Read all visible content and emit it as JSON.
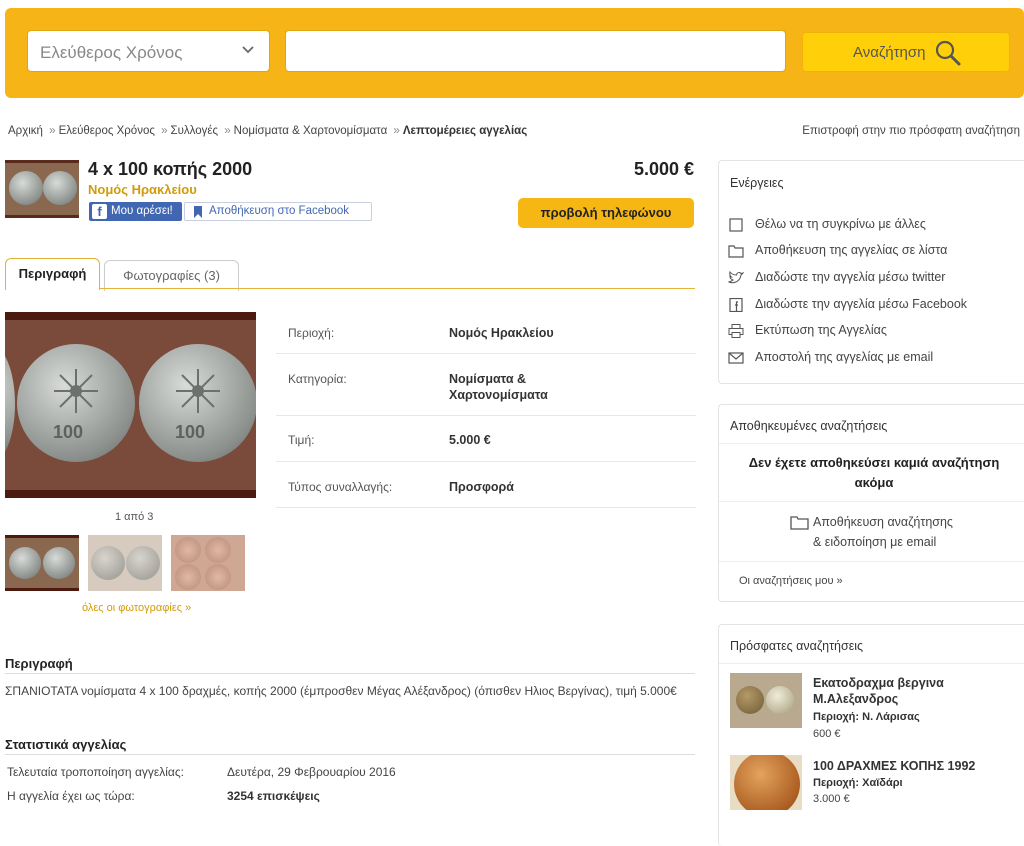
{
  "header": {
    "category_select": "Ελεύθερος Χρόνος",
    "search_value": "",
    "search_placeholder": "",
    "search_button": "Αναζήτηση"
  },
  "breadcrumb": {
    "items": [
      "Αρχική",
      "Ελεύθερος Χρόνος",
      "Συλλογές",
      "Νομίσματα & Χαρτονομίσματα"
    ],
    "current": "Λεπτομέρειες αγγελίας",
    "back_link": "Επιστροφή στην πιο πρόσφατη αναζήτηση"
  },
  "ad": {
    "title": "4 x 100 κοπής 2000",
    "region": "Νομός Ηρακλείου",
    "price": "5.000 €",
    "like_label": "Μου αρέσει!",
    "save_fb_label": "Αποθήκευση στο Facebook",
    "phone_button": "προβολή τηλεφώνου"
  },
  "tabs": [
    {
      "label": "Περιγραφή",
      "active": true
    },
    {
      "label": "Φωτογραφίες (3)",
      "active": false
    }
  ],
  "gallery": {
    "counter": "1 από 3",
    "all_photos": "όλες οι φωτογραφίες »"
  },
  "details": [
    {
      "label": "Περιοχή:",
      "value": "Νομός Ηρακλείου"
    },
    {
      "label": "Κατηγορία:",
      "value": "Νομίσματα & Χαρτονομίσματα"
    },
    {
      "label": "Τιμή:",
      "value": "5.000 €"
    },
    {
      "label": "Τύπος συναλλαγής:",
      "value": "Προσφορά"
    }
  ],
  "description": {
    "heading": "Περιγραφή",
    "text": "ΣΠΑΝΙΟΤΑΤΑ νομίσματα 4 x 100 δραχμές, κοπής 2000 (έμπροσθεν Μέγας Αλέξανδρος) (όπισθεν Ηλιος Βεργίνας), τιμή 5.000€"
  },
  "stats": {
    "heading": "Στατιστικά αγγελίας",
    "last_modified_label": "Τελευταία τροποποίηση αγγελίας:",
    "last_modified_value": "Δευτέρα, 29 Φεβρουαρίου 2016",
    "views_label": "Η αγγελία έχει ως τώρα:",
    "views_value": "3254 επισκέψεις"
  },
  "actions": {
    "title": "Ενέργειες",
    "items": [
      {
        "label": "Θέλω να τη συγκρίνω με άλλες",
        "icon": "checkbox-icon"
      },
      {
        "label": "Αποθήκευση της αγγελίας σε λίστα",
        "icon": "folder-icon"
      },
      {
        "label": "Διαδώστε την αγγελία μέσω twitter",
        "icon": "twitter-icon"
      },
      {
        "label": "Διαδώστε την αγγελία μέσω Facebook",
        "icon": "facebook-icon"
      },
      {
        "label": "Εκτύπωση της Αγγελίας",
        "icon": "printer-icon"
      },
      {
        "label": "Αποστολή της αγγελίας με email",
        "icon": "envelope-icon"
      }
    ]
  },
  "saved_searches": {
    "title": "Αποθηκευμένες αναζητήσεις",
    "empty_text": "Δεν έχετε αποθηκεύσει καμιά αναζήτηση ακόμα",
    "save_line1": "Αποθήκευση αναζήτησης",
    "save_line2": "& ειδοποίηση με email",
    "my_searches": "Οι αναζητήσεις μου »"
  },
  "recent": {
    "title": "Πρόσφατες αναζητήσεις",
    "items": [
      {
        "title": "Εκατοδραχμα βεργινα Μ.Αλεξανδρος",
        "region": "Περιοχή: Ν. Λάρισας",
        "price": "600 €"
      },
      {
        "title": "100 ΔΡΑΧΜΕΣ ΚΟΠΗΣ 1992",
        "region": "Περιοχή: Χαϊδάρι",
        "price": "3.000 €"
      }
    ]
  },
  "colors": {
    "brand_yellow": "#f7b416",
    "search_button": "#ffd00a",
    "link_gold": "#d19b08",
    "facebook_blue": "#4267b2"
  }
}
